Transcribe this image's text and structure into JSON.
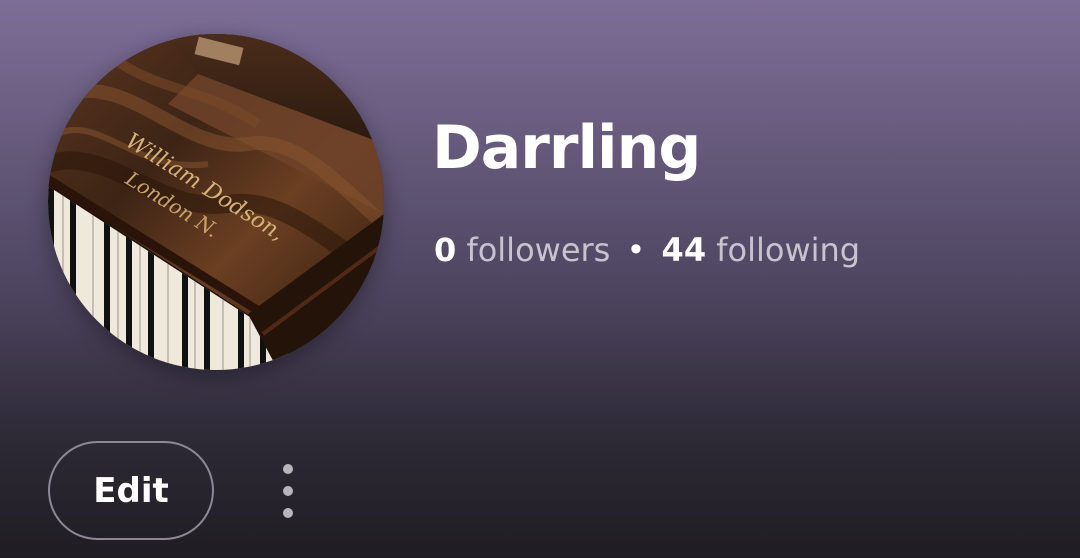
{
  "profile": {
    "name": "Darrling",
    "avatar_icon": "piano-photo",
    "followers_count": "0",
    "followers_label": "followers",
    "separator": "•",
    "following_count": "44",
    "following_label": "following",
    "avatar_text_line1": "William Dodson,",
    "avatar_text_line2": "London N."
  },
  "actions": {
    "edit_label": "Edit",
    "more_icon": "more-vertical-icon"
  },
  "colors": {
    "gradient_top": "#7d6e97",
    "gradient_bottom": "#1f1d23",
    "text_primary": "#ffffff",
    "text_secondary": "#c7c3cf"
  }
}
